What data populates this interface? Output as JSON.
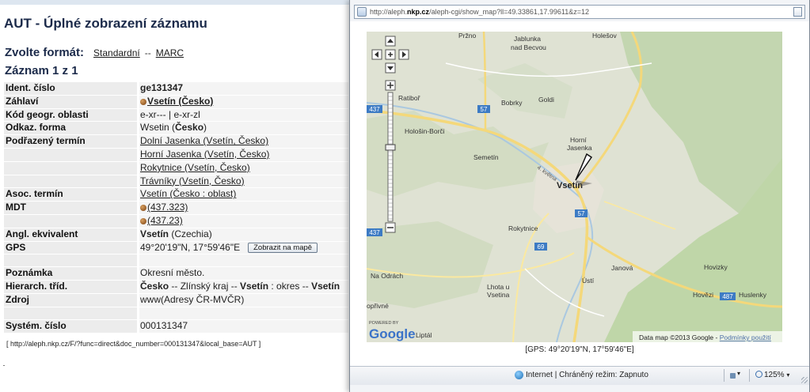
{
  "record": {
    "title": "AUT - Úplné zobrazení záznamu",
    "format": {
      "label": "Zvolte formát:",
      "options": [
        "Standardní",
        "MARC"
      ],
      "separator": "--"
    },
    "count": "Záznam 1 z 1",
    "fields": {
      "ident": {
        "label": "Ident. číslo",
        "value": "ge131347"
      },
      "zahlavi": {
        "label": "Záhlaví",
        "value": "Vsetín (Česko)"
      },
      "kod": {
        "label": "Kód geogr. oblasti",
        "value": "e-xr--- | e-xr-zl"
      },
      "odkaz": {
        "label": "Odkaz. forma",
        "value_prefix": "Wsetin (",
        "value_bold": "Česko",
        "value_suffix": ")"
      },
      "podrazeny": {
        "label": "Podřazený termín",
        "values": [
          "Dolní Jasenka (Vsetín, Česko)",
          "Horní Jasenka (Vsetín, Česko)",
          "Rokytnice (Vsetín, Česko)",
          "Trávníky (Vsetín, Česko)"
        ]
      },
      "asoc": {
        "label": "Asoc. termín",
        "value": "Vsetín (Česko : oblast)"
      },
      "mdt": {
        "label": "MDT",
        "values": [
          "(437.323)",
          "(437.23)"
        ]
      },
      "angl": {
        "label": "Angl. ekvivalent",
        "value_bold": "Vsetín",
        "value_suffix": " (Czechia)"
      },
      "gps": {
        "label": "GPS",
        "value": "49°20'19\"N, 17°59'46\"E",
        "button": "Zobrazit na mapě"
      },
      "poznamka": {
        "label": "Poznámka",
        "value": "Okresní město."
      },
      "hierarch": {
        "label": "Hierarch. tříd.",
        "p1": "Česko",
        "p2": " -- Zlínský kraj -- ",
        "p3": "Vsetín",
        "p4": " : okres -- ",
        "p5": "Vsetín"
      },
      "zdroj": {
        "label": "Zdroj",
        "value": "www(Adresy ČR-MVČR)"
      },
      "system": {
        "label": "Systém. číslo",
        "value": "000131347"
      }
    },
    "permalink": "[ http://aleph.nkp.cz/F/?func=direct&doc_number=000131347&local_base=AUT ]"
  },
  "popup": {
    "url_prefix": "http://aleph.",
    "url_domain": "nkp.cz",
    "url_suffix": "/aleph-cgi/show_map?ll=49.33861,17.99611&z=12",
    "map": {
      "places": {
        "przno": "Pržno",
        "jablunka1": "Jablunka",
        "jablunka2": "nad Becvou",
        "holesov": "Holešov",
        "ratibor": "Ratiboř",
        "bobrky": "Bobrky",
        "goldi": "Goldi",
        "holosin": "Hološin-Borči",
        "semetin": "Semetín",
        "horni1": "Horní",
        "horni2": "Jasenka",
        "vsetin": "Vsetín",
        "rokytnice": "Rokytnice",
        "janova": "Janová",
        "hovizky": "Hovizky",
        "hovezi": "Hovězi",
        "huslenky": "Huslenky",
        "odrach": "Na Odrách",
        "lhota1": "Lhota u",
        "lhota2": "Vsetina",
        "usti": "Ústí",
        "opirne": "opřivné",
        "liptal": "Liptál",
        "street": "4. května"
      },
      "roads": {
        "r437a": "437",
        "r57a": "57",
        "r57b": "57",
        "r69": "69",
        "r437b": "437",
        "r487": "487"
      },
      "powered": "POWERED BY",
      "google": "Google",
      "copyright": "Data map ©2013 Google - ",
      "terms": "Podmínky použití"
    },
    "caption": "[GPS: 49°20'19\"N, 17°59'46\"E]",
    "status": {
      "zone": "Internet | Chráněný režim: Zapnuto",
      "zoom": "125%"
    }
  }
}
